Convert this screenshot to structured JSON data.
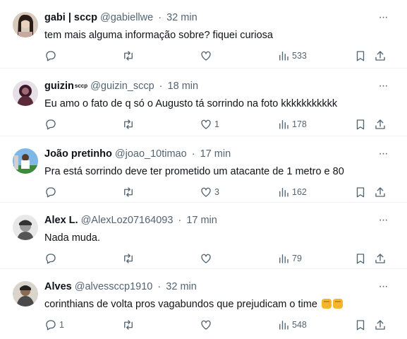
{
  "tweets": [
    {
      "name": "gabi | sccp",
      "badge": "",
      "handle": "@gabiellwe",
      "dot": "·",
      "time": "32 min",
      "text": "tem mais alguma informação sobre? fiquei curiosa",
      "reply_count": "",
      "retweet_count": "",
      "like_count": "",
      "view_count": "533",
      "avatar_color": "#c9b8a8"
    },
    {
      "name": "guizin",
      "badge": "sccp",
      "handle": "@guizin_sccp",
      "dot": "·",
      "time": "18 min",
      "text": "Eu amo o fato de q só o Augusto tá sorrindo na foto kkkkkkkkkkk",
      "reply_count": "",
      "retweet_count": "",
      "like_count": "1",
      "view_count": "178",
      "avatar_color": "#5a2a3a"
    },
    {
      "name": "João pretinho",
      "badge": "",
      "handle": "@joao_10timao",
      "dot": "·",
      "time": "17 min",
      "text": "Pra está sorrindo deve ter prometido um atacante de 1 metro e 80",
      "reply_count": "",
      "retweet_count": "",
      "like_count": "3",
      "view_count": "162",
      "avatar_color": "#4a8fd0"
    },
    {
      "name": "Alex L.",
      "badge": "",
      "handle": "@AlexLoz07164093",
      "dot": "·",
      "time": "17 min",
      "text": "Nada muda.",
      "reply_count": "",
      "retweet_count": "",
      "like_count": "",
      "view_count": "79",
      "avatar_color": "#888888"
    },
    {
      "name": "Alves",
      "badge": "",
      "handle": "@alvessccp1910",
      "dot": "·",
      "time": "32 min",
      "text": "corinthians de volta pros vagabundos que prejudicam o time",
      "reply_count": "1",
      "retweet_count": "",
      "like_count": "",
      "view_count": "548",
      "avatar_color": "#6b6256"
    }
  ],
  "icons": {
    "more": "more-icon",
    "reply": "reply-icon",
    "retweet": "retweet-icon",
    "like": "heart-icon",
    "views": "views-icon",
    "bookmark": "bookmark-icon",
    "share": "share-icon"
  },
  "colors": {
    "text_primary": "#0f1419",
    "text_secondary": "#536471",
    "divider": "#eff3f4"
  }
}
